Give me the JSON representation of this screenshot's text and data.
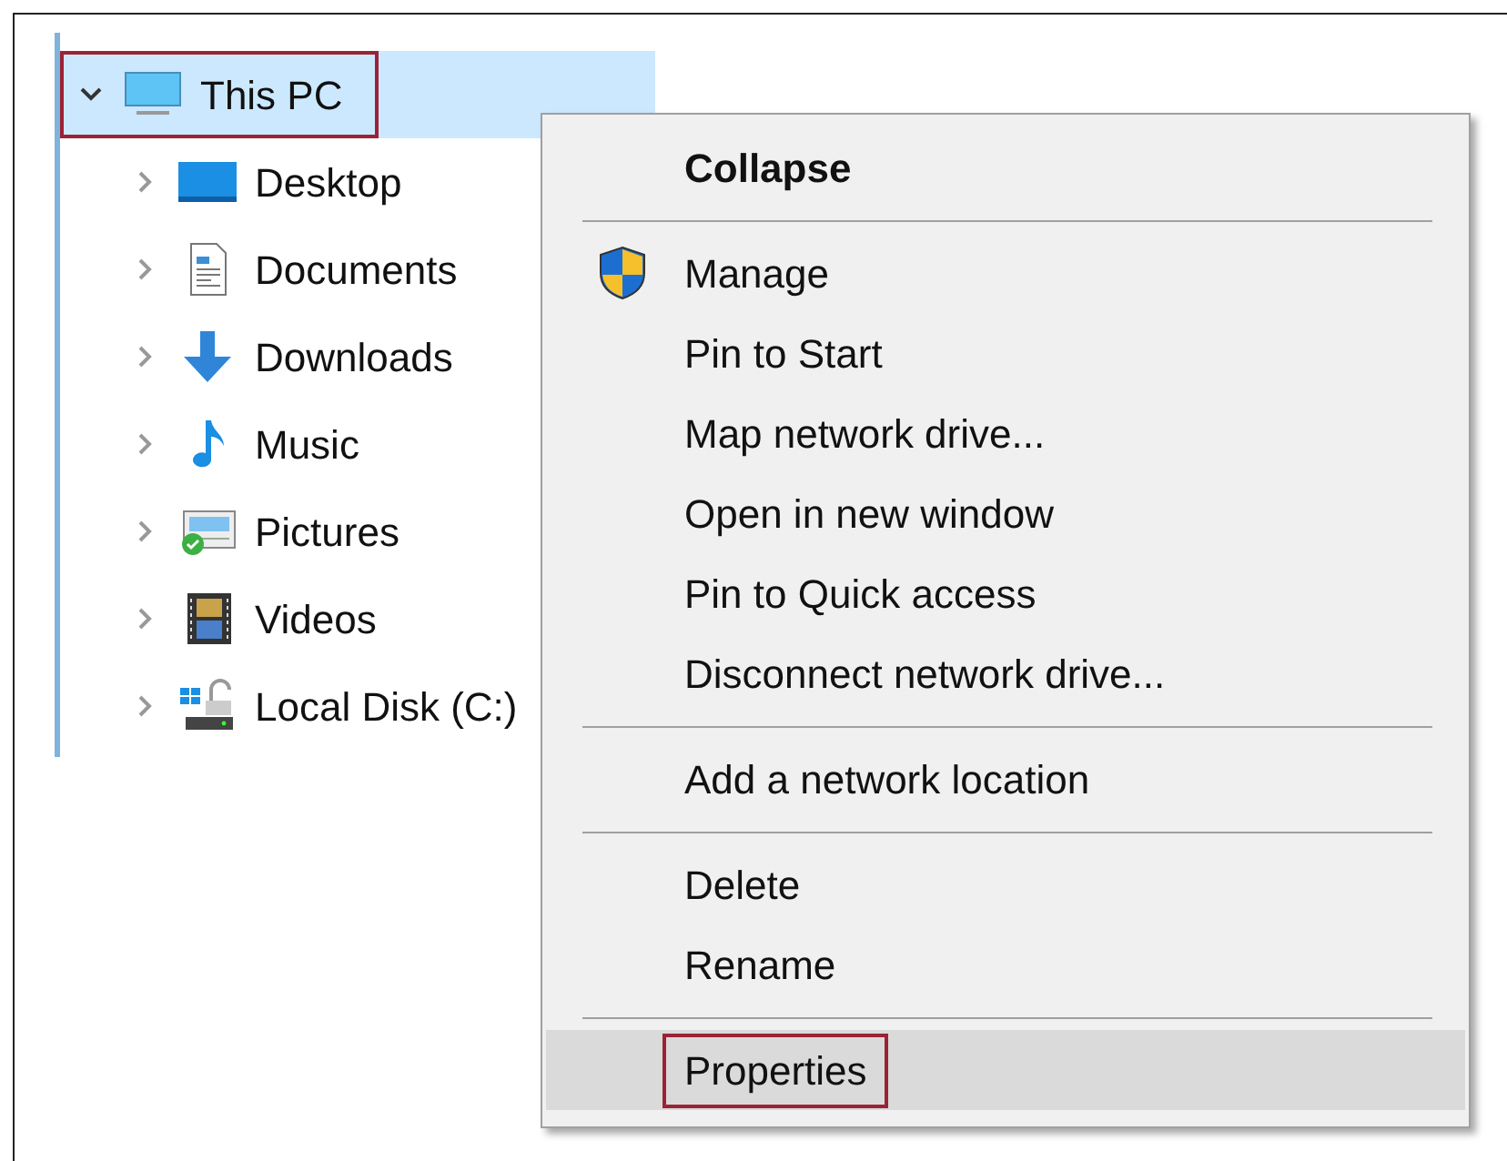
{
  "tree": {
    "label": "This PC",
    "kind": "computer",
    "expanded": true,
    "selected": true,
    "annotated": true,
    "children": [
      {
        "label": "Desktop",
        "kind": "desktop",
        "expanded": false
      },
      {
        "label": "Documents",
        "kind": "documents",
        "expanded": false
      },
      {
        "label": "Downloads",
        "kind": "downloads",
        "expanded": false
      },
      {
        "label": "Music",
        "kind": "music",
        "expanded": false
      },
      {
        "label": "Pictures",
        "kind": "pictures",
        "expanded": false
      },
      {
        "label": "Videos",
        "kind": "videos",
        "expanded": false
      },
      {
        "label": "Local Disk (C:)",
        "kind": "disk",
        "expanded": false
      }
    ]
  },
  "context_menu": {
    "items": [
      {
        "kind": "item",
        "label": "Collapse",
        "default": true,
        "elevated": false,
        "selected": false,
        "annotated": false
      },
      {
        "kind": "separator"
      },
      {
        "kind": "item",
        "label": "Manage",
        "default": false,
        "elevated": true,
        "selected": false,
        "annotated": false
      },
      {
        "kind": "item",
        "label": "Pin to Start",
        "default": false,
        "elevated": false,
        "selected": false,
        "annotated": false
      },
      {
        "kind": "item",
        "label": "Map network drive...",
        "default": false,
        "elevated": false,
        "selected": false,
        "annotated": false
      },
      {
        "kind": "item",
        "label": "Open in new window",
        "default": false,
        "elevated": false,
        "selected": false,
        "annotated": false
      },
      {
        "kind": "item",
        "label": "Pin to Quick access",
        "default": false,
        "elevated": false,
        "selected": false,
        "annotated": false
      },
      {
        "kind": "item",
        "label": "Disconnect network drive...",
        "default": false,
        "elevated": false,
        "selected": false,
        "annotated": false
      },
      {
        "kind": "separator"
      },
      {
        "kind": "item",
        "label": "Add a network location",
        "default": false,
        "elevated": false,
        "selected": false,
        "annotated": false
      },
      {
        "kind": "separator"
      },
      {
        "kind": "item",
        "label": "Delete",
        "default": false,
        "elevated": false,
        "selected": false,
        "annotated": false
      },
      {
        "kind": "item",
        "label": "Rename",
        "default": false,
        "elevated": false,
        "selected": false,
        "annotated": false
      },
      {
        "kind": "separator"
      },
      {
        "kind": "item",
        "label": "Properties",
        "default": false,
        "elevated": false,
        "selected": true,
        "annotated": true
      }
    ]
  }
}
